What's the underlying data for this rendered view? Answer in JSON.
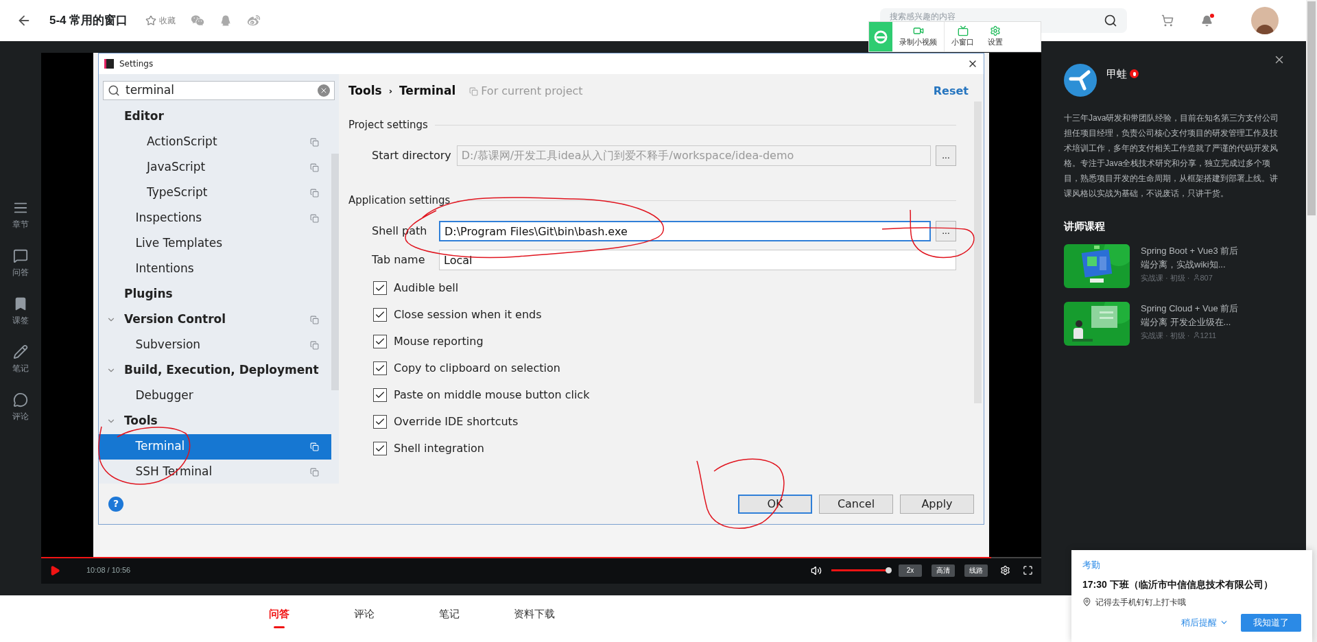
{
  "header": {
    "title": "5-4 常用的窗口",
    "favorite": "收藏",
    "search": {
      "placeholder": "搜索感兴趣的内容"
    },
    "notifications_unread": true
  },
  "recorder_toolbar": [
    {
      "kind": "record",
      "label": "录制小视频"
    },
    {
      "kind": "mini",
      "label": "小窗口"
    },
    {
      "kind": "settings",
      "label": "设置"
    }
  ],
  "side_rail": [
    {
      "kind": "chapters",
      "label": "章节"
    },
    {
      "kind": "qa",
      "label": "问答"
    },
    {
      "kind": "bookmark",
      "label": "课签"
    },
    {
      "kind": "notes",
      "label": "笔记"
    },
    {
      "kind": "comments",
      "label": "评论"
    }
  ],
  "settings_dialog": {
    "title": "Settings",
    "search": {
      "value": "terminal"
    },
    "tree": [
      {
        "label": "Editor",
        "project_scoped": false,
        "selected": false,
        "children": [
          {
            "children": [
              {
                "label": "ActionScript",
                "project_scoped": true,
                "selected": false
              },
              {
                "label": "JavaScript",
                "project_scoped": true,
                "selected": false
              },
              {
                "label": "TypeScript",
                "project_scoped": true,
                "selected": false
              }
            ]
          },
          {
            "label": "Inspections",
            "project_scoped": true,
            "selected": false
          },
          {
            "label": "Live Templates",
            "project_scoped": false,
            "selected": false
          },
          {
            "label": "Intentions",
            "project_scoped": false,
            "selected": false
          }
        ]
      },
      {
        "label": "Plugins",
        "project_scoped": false,
        "selected": false
      },
      {
        "label": "Version Control",
        "expanded": true,
        "project_scoped": true,
        "selected": false,
        "children": [
          {
            "label": "Subversion",
            "project_scoped": true,
            "selected": false
          }
        ]
      },
      {
        "label": "Build, Execution, Deployment",
        "expanded": true,
        "project_scoped": false,
        "selected": false,
        "children": [
          {
            "label": "Debugger",
            "project_scoped": false,
            "selected": false
          }
        ]
      },
      {
        "label": "Tools",
        "expanded": true,
        "project_scoped": false,
        "selected": false,
        "children": [
          {
            "label": "Terminal",
            "project_scoped": true,
            "selected": true
          },
          {
            "label": "SSH Terminal",
            "project_scoped": true,
            "selected": false
          }
        ]
      }
    ],
    "breadcrumb": [
      "Tools",
      "›",
      "Terminal"
    ],
    "scope": "For current project",
    "reset": "Reset",
    "sections": [
      {
        "title": "Project settings",
        "fields": [
          {
            "label": "Start directory",
            "value": "D:/慕课网/开发工具idea从入门到爱不释手/workspace/idea-demo",
            "disabled": true,
            "focused": false,
            "browse": "..."
          }
        ]
      },
      {
        "title": "Application settings",
        "fields": [
          {
            "label": "Shell path",
            "value": "D:\\Program Files\\Git\\bin\\bash.exe",
            "disabled": false,
            "focused": true,
            "browse": "..."
          },
          {
            "label": "Tab name",
            "value": "Local",
            "disabled": false,
            "focused": false
          }
        ],
        "options": [
          {
            "label": "Audible bell",
            "checked": true
          },
          {
            "label": "Close session when it ends",
            "checked": true
          },
          {
            "label": "Mouse reporting",
            "checked": true
          },
          {
            "label": "Copy to clipboard on selection",
            "checked": true
          },
          {
            "label": "Paste on middle mouse button click",
            "checked": true
          },
          {
            "label": "Override IDE shortcuts",
            "checked": true
          },
          {
            "label": "Shell integration",
            "checked": true
          }
        ]
      }
    ],
    "help": "?",
    "buttons": [
      {
        "label": "OK",
        "default": true
      },
      {
        "label": "Cancel",
        "default": false
      },
      {
        "label": "Apply",
        "default": false
      }
    ]
  },
  "player": {
    "time": "10:08 / 10:56",
    "progress": {
      "level": 0.95
    },
    "volume": {
      "level": 1
    },
    "buttons": [
      "2x",
      "高清",
      "线路"
    ]
  },
  "teacher": {
    "name": "甲蛙",
    "bio": "十三年Java研发和带团队经验，目前在知名第三方支付公司担任项目经理，负责公司核心支付项目的研发管理工作及技术培训工作，多年的支付相关工作造就了严谨的代码开发风格。专注于Java全栈技术研究和分享，独立完成过多个项目，熟悉项目开发的生命周期，从框架搭建到部署上线。讲课风格以实战为基础，不说废话，只讲干货。",
    "courses_title": "讲师课程",
    "courses": [
      {
        "title": "Spring Boot + Vue3 前后端分离，实战wiki知...",
        "meta": "实战课 · 初级 ·",
        "learners": "807"
      },
      {
        "title": "Spring Cloud + Vue 前后端分离 开发企业级在...",
        "meta": "实战课 · 初级 ·",
        "learners": "1211"
      }
    ]
  },
  "tabs": [
    {
      "label": "问答",
      "selected": true
    },
    {
      "label": "评论",
      "selected": false
    },
    {
      "label": "笔记",
      "selected": false
    },
    {
      "label": "资料下载",
      "selected": false
    }
  ],
  "reminder": {
    "title": "考勤",
    "event": "17:30 下班（临沂市中信信息技术有限公司）",
    "hint": "记得去手机钉钉上打卡哦",
    "later": "稍后提醒",
    "confirm": "我知道了"
  }
}
